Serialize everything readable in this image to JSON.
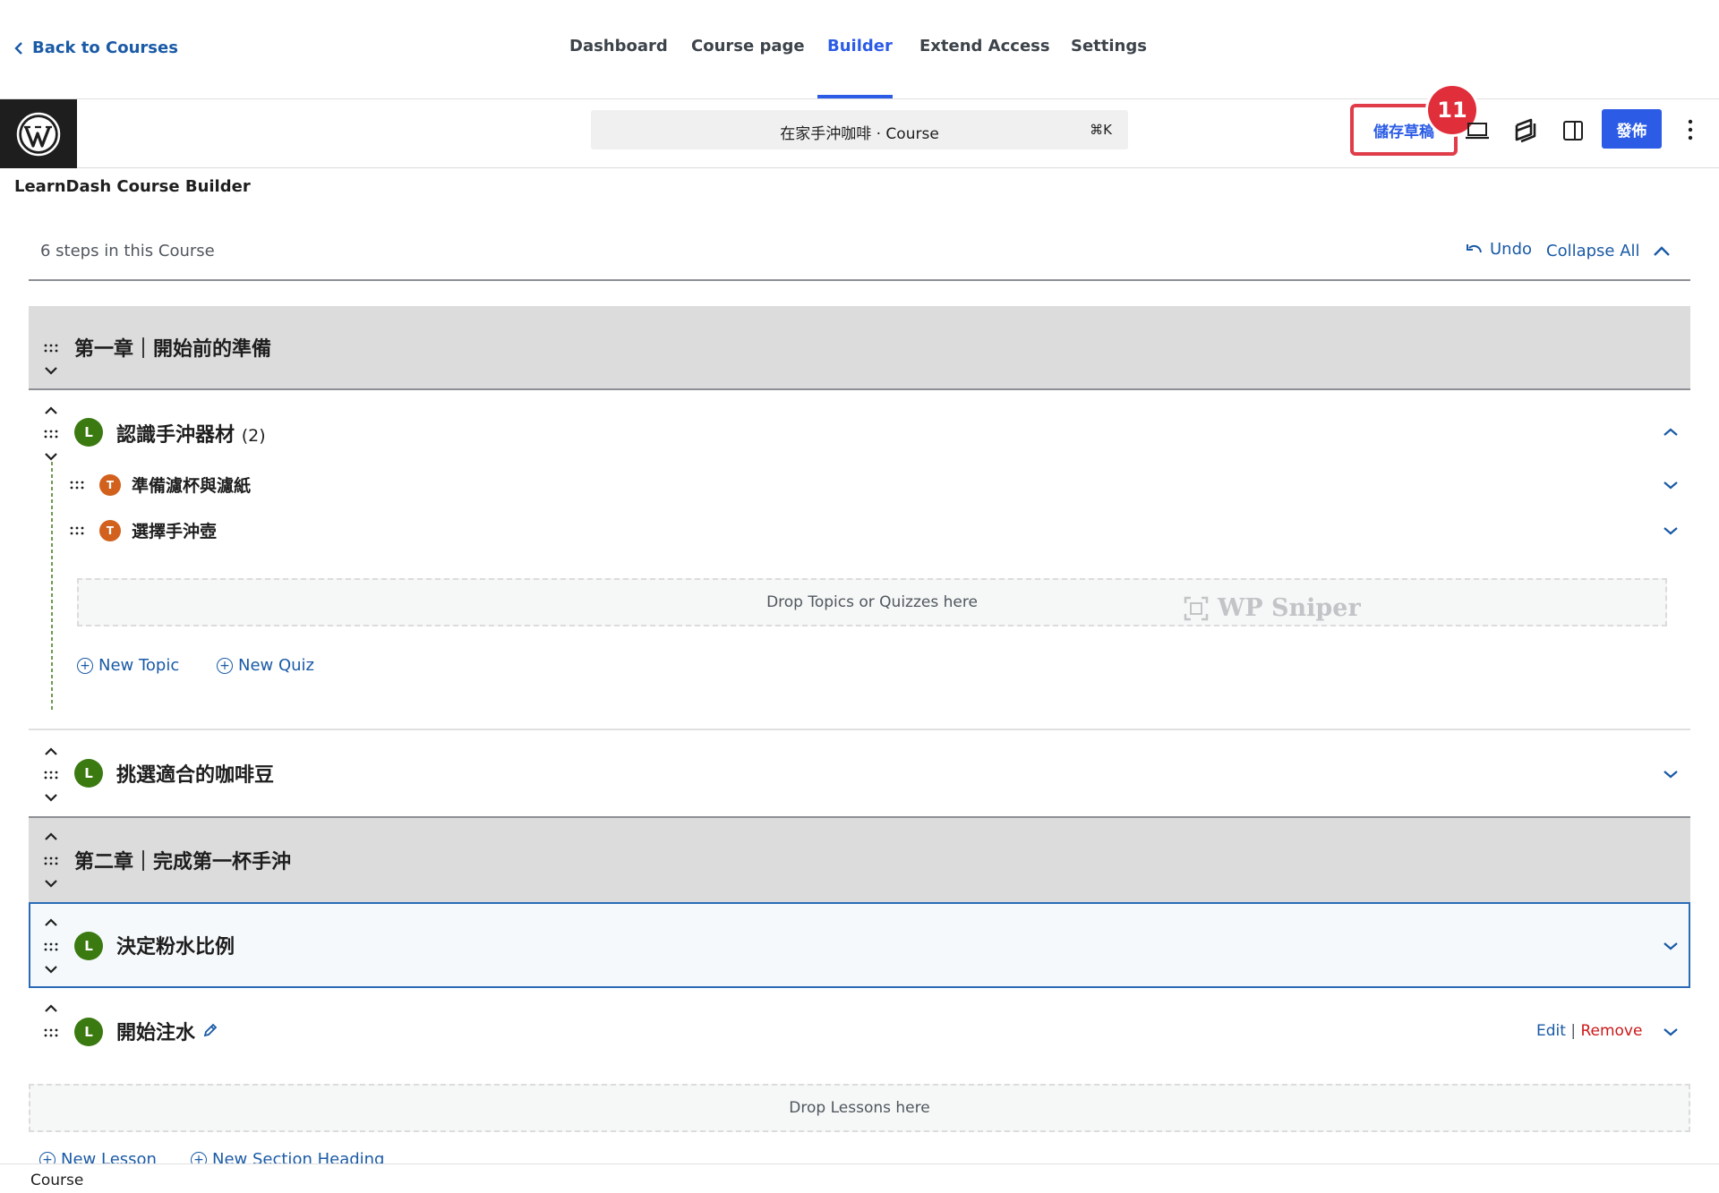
{
  "nav": {
    "back_label": "Back to Courses",
    "tabs": [
      {
        "label": "Dashboard"
      },
      {
        "label": "Course page"
      },
      {
        "label": "Builder"
      },
      {
        "label": "Extend Access"
      },
      {
        "label": "Settings"
      }
    ],
    "active_tab": "Builder"
  },
  "editor": {
    "command_title": "在家手沖咖啡 · Course",
    "command_shortcut": "⌘K",
    "save_draft_label": "儲存草稿",
    "annotation_number": "11",
    "publish_label": "發佈"
  },
  "builder": {
    "title": "LearnDash Course Builder",
    "steps_count": "6 steps in this Course",
    "undo_label": "Undo",
    "collapse_all_label": "Collapse All",
    "sections": [
      {
        "title": "第一章｜開始前的準備"
      },
      {
        "title": "第二章｜完成第一杯手沖"
      }
    ],
    "lessons": [
      {
        "badge": "L",
        "title": "認識手沖器材",
        "count": "(2)",
        "topics": [
          {
            "badge": "T",
            "title": "準備濾杯與濾紙"
          },
          {
            "badge": "T",
            "title": "選擇手沖壺"
          }
        ],
        "drop_label": "Drop Topics or Quizzes here",
        "new_topic_label": "New Topic",
        "new_quiz_label": "New Quiz"
      },
      {
        "badge": "L",
        "title": "挑選適合的咖啡豆"
      },
      {
        "badge": "L",
        "title": "決定粉水比例"
      },
      {
        "badge": "L",
        "title": "開始注水",
        "edit_label": "Edit",
        "separator": "|",
        "remove_label": "Remove"
      }
    ],
    "drop_lessons_label": "Drop Lessons here",
    "new_lesson_label": "New Lesson",
    "new_section_label": "New Section Heading"
  },
  "watermark": {
    "text": "WP Sniper"
  },
  "footer": {
    "label": "Course"
  },
  "colors": {
    "accent": "#2c5ce6",
    "link": "#1a5aa6",
    "lesson_badge": "#3a7a10",
    "topic_badge": "#d2611e",
    "annotation": "#e02f3b",
    "remove": "#cc1818"
  }
}
